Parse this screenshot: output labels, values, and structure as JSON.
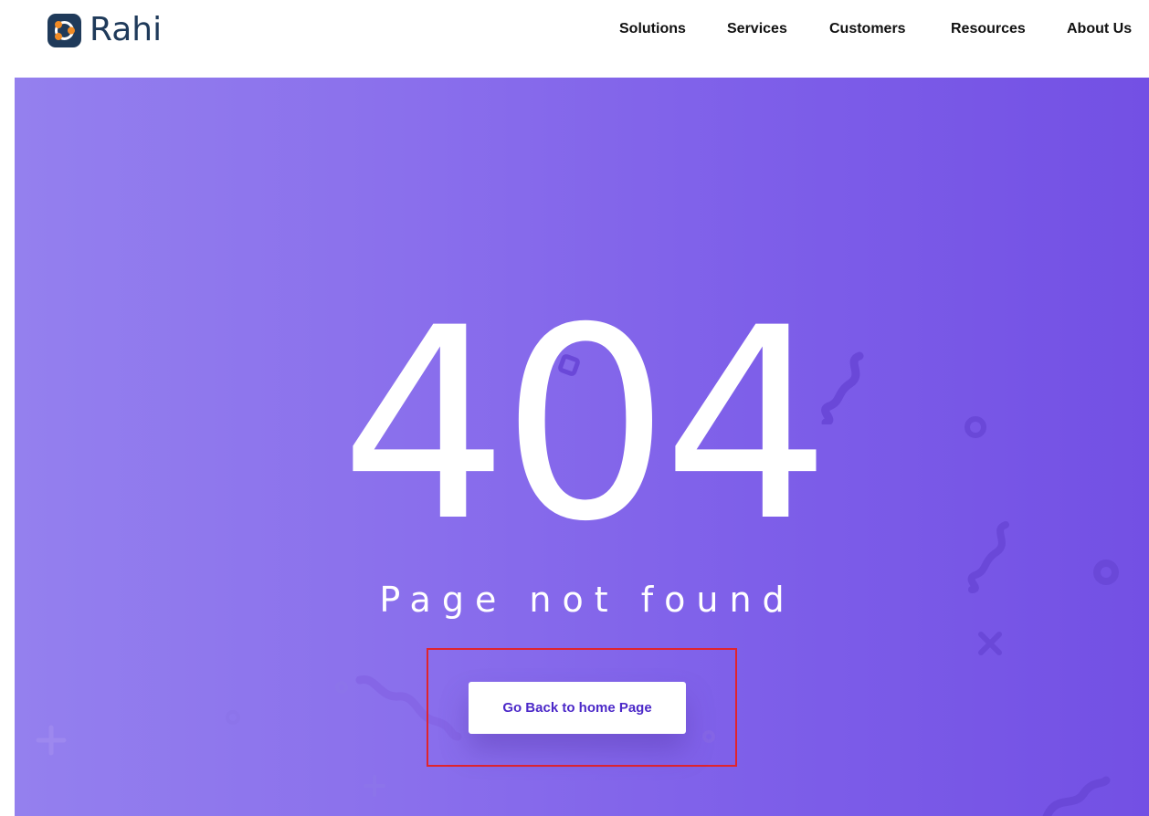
{
  "brand": {
    "name": "Rahi"
  },
  "nav": {
    "items": [
      {
        "label": "Solutions"
      },
      {
        "label": "Services"
      },
      {
        "label": "Customers"
      },
      {
        "label": "Resources"
      },
      {
        "label": "About Us"
      }
    ]
  },
  "hero": {
    "code": "404",
    "message": "Page not found",
    "button_label": "Go Back to home Page"
  },
  "colors": {
    "brand": "#1f3a5a",
    "accent_orange": "#f08a24",
    "hero_start": "#9480ee",
    "hero_end": "#7350e4",
    "button_text": "#4b28c8",
    "highlight_border": "#e0242d"
  }
}
